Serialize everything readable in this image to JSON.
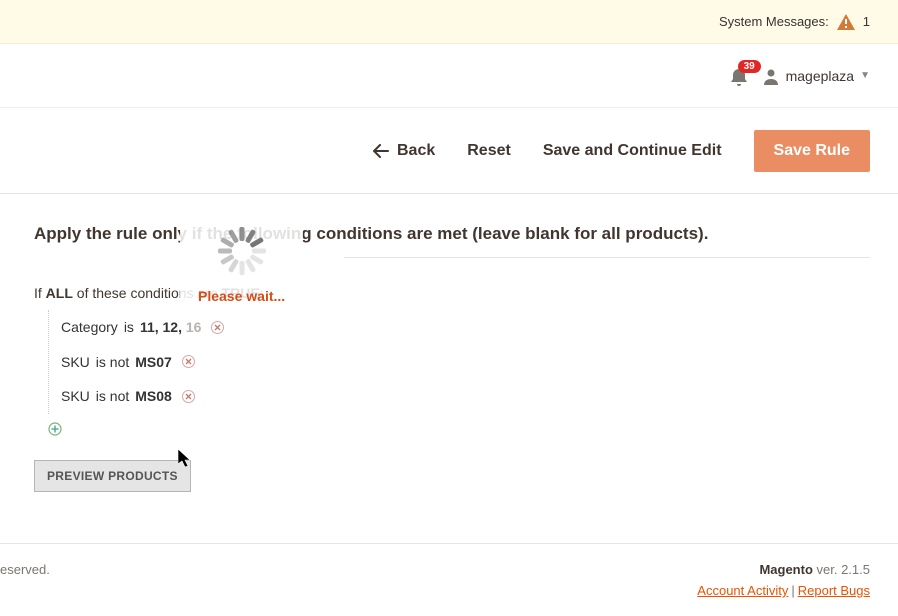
{
  "system_bar": {
    "label": "System Messages:",
    "count": "1"
  },
  "header": {
    "notif_count": "39",
    "username": "mageplaza"
  },
  "actions": {
    "back": "Back",
    "reset": "Reset",
    "save_continue": "Save and Continue Edit",
    "save_rule": "Save Rule"
  },
  "section": {
    "title": "Apply the rule only if the following conditions are met (leave blank for all products)."
  },
  "rule": {
    "prefix": "If",
    "aggregator": "ALL",
    "middle": "of these conditions are",
    "value_label": "TRUE",
    "suffix": ":"
  },
  "conditions": [
    {
      "attr": "Category",
      "op": "is",
      "val": "11, 12,",
      "extra": "16"
    },
    {
      "attr": "SKU",
      "op": "is not",
      "val": "MS07"
    },
    {
      "attr": "SKU",
      "op": "is not",
      "val": "MS08"
    }
  ],
  "buttons": {
    "preview": "PREVIEW PRODUCTS"
  },
  "loading": {
    "text": "Please wait..."
  },
  "footer": {
    "left": "eserved.",
    "brand": "Magento",
    "version": "ver. 2.1.5",
    "account_activity": "Account Activity",
    "report_bugs": "Report Bugs"
  }
}
